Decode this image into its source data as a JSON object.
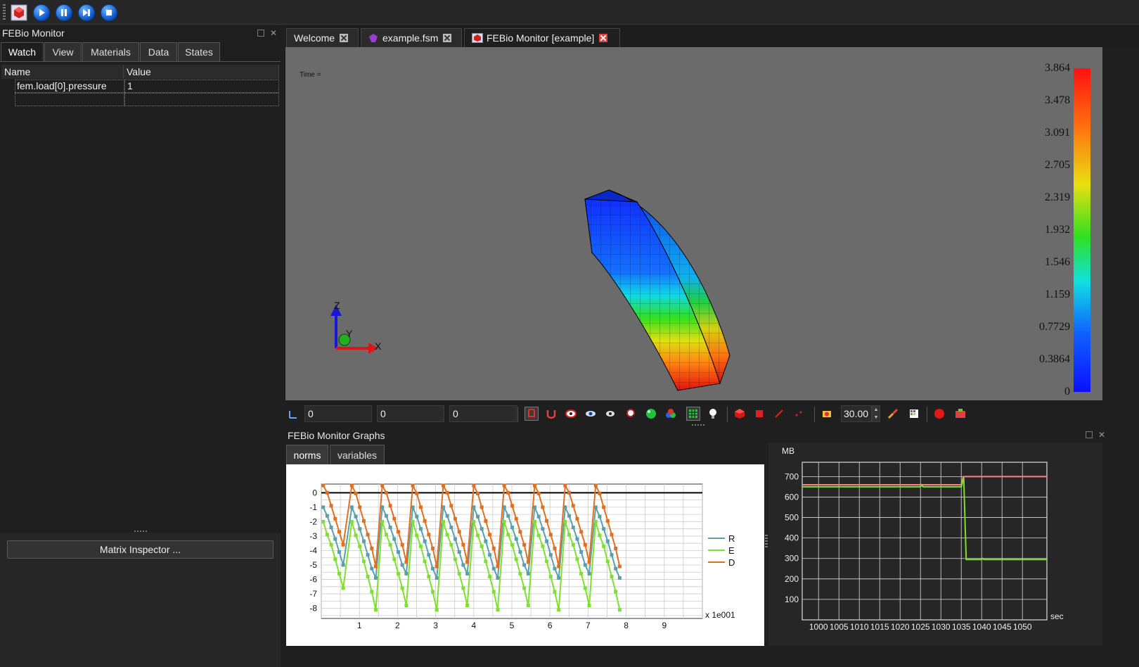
{
  "toolbar": {
    "buttons": [
      {
        "name": "febio-app-icon"
      },
      {
        "name": "run-icon"
      },
      {
        "name": "pause-icon"
      },
      {
        "name": "step-forward-icon"
      },
      {
        "name": "stop-icon"
      }
    ]
  },
  "left_panel": {
    "title": "FEBio Monitor",
    "tabs": [
      "Watch",
      "View",
      "Materials",
      "Data",
      "States"
    ],
    "active_tab": "Watch",
    "columns": [
      "Name",
      "Value"
    ],
    "rows": [
      {
        "name": "fem.load[0].pressure",
        "value": "1"
      }
    ],
    "matrix_button": "Matrix Inspector ..."
  },
  "doc_tabs": [
    {
      "label": "Welcome"
    },
    {
      "label": "example.fsm"
    },
    {
      "label": "FEBio Monitor [example]"
    }
  ],
  "viewport": {
    "time_label": "Time =",
    "axes": {
      "x": "X",
      "y": "Y",
      "z": "Z"
    },
    "colorbar_ticks": [
      "3.864",
      "3.478",
      "3.091",
      "2.705",
      "2.319",
      "1.932",
      "1.546",
      "1.159",
      "0.7729",
      "0.3864",
      "0"
    ]
  },
  "controls": {
    "coord_x": "0",
    "coord_y": "0",
    "coord_z": "0",
    "zoom_value": "30.00"
  },
  "graphs": {
    "title": "FEBio Monitor Graphs",
    "tabs": [
      "norms",
      "variables"
    ],
    "active_tab": "norms"
  },
  "chart_data": [
    {
      "type": "line",
      "x_scale_label": "x 1e001",
      "x_ticks": [
        "1",
        "2",
        "3",
        "4",
        "5",
        "6",
        "7",
        "8",
        "9"
      ],
      "y_ticks": [
        "0",
        "-1",
        "-2",
        "-3",
        "-4",
        "-5",
        "-6",
        "-7",
        "-8"
      ],
      "xlim": [
        0,
        10
      ],
      "ylim": [
        -8.7,
        0.6
      ],
      "grid": true,
      "legend_position": "right",
      "series": [
        {
          "name": "R",
          "color": "#5aa0a8",
          "values": [
            -1,
            -1.6,
            -2.4,
            -3.2,
            -4.1,
            -5.0,
            -5.6
          ]
        },
        {
          "name": "E",
          "color": "#7fe030",
          "values": [
            -2,
            -2.9,
            -3.6,
            -4.6,
            -5.6,
            -6.6,
            -7.8
          ]
        },
        {
          "name": "D",
          "color": "#e07020",
          "values": [
            0.5,
            0,
            -0.9,
            -1.8,
            -2.7,
            -3.6,
            -4.8
          ]
        }
      ]
    },
    {
      "type": "line",
      "ylabel": "MB",
      "xlabel": "sec",
      "x_ticks": [
        "1000",
        "1005",
        "1010",
        "1015",
        "1020",
        "1025",
        "1030",
        "1035",
        "1040",
        "1045",
        "1050"
      ],
      "y_ticks": [
        "700",
        "600",
        "500",
        "400",
        "300",
        "200",
        "100"
      ],
      "xlim": [
        996,
        1056
      ],
      "ylim": [
        0,
        770
      ],
      "grid": true,
      "series": [
        {
          "color": "#ff8080",
          "x": [
            996,
            1035,
            1035.5,
            1056
          ],
          "y": [
            660,
            660,
            700,
            700
          ]
        },
        {
          "color": "#7fe030",
          "x": [
            996,
            1025,
            1025.3,
            1025.6,
            1035,
            1035.6,
            1036.2,
            1040,
            1040.3,
            1040.6,
            1056
          ],
          "y": [
            650,
            650,
            660,
            650,
            650,
            695,
            295,
            295,
            300,
            295,
            295
          ]
        }
      ]
    }
  ]
}
